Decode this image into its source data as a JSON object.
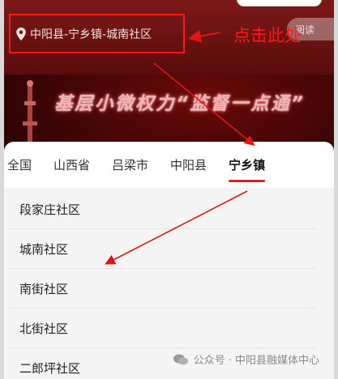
{
  "header": {
    "location": "中阳县-宁乡镇-城南社区",
    "read_label": "阅读",
    "annotation": "点击此处"
  },
  "banner": {
    "slogan": "基层小微权力“监督一点通”"
  },
  "tabs": [
    {
      "label": "全国",
      "active": false
    },
    {
      "label": "山西省",
      "active": false
    },
    {
      "label": "吕梁市",
      "active": false
    },
    {
      "label": "中阳县",
      "active": false
    },
    {
      "label": "宁乡镇",
      "active": true
    }
  ],
  "communities": [
    "段家庄社区",
    "城南社区",
    "南街社区",
    "北街社区",
    "二郎坪社区"
  ],
  "watermark": "公众号 · 中阳县融媒体中心",
  "colors": {
    "accent": "#d8222a",
    "annotation": "#ff1a1a"
  }
}
